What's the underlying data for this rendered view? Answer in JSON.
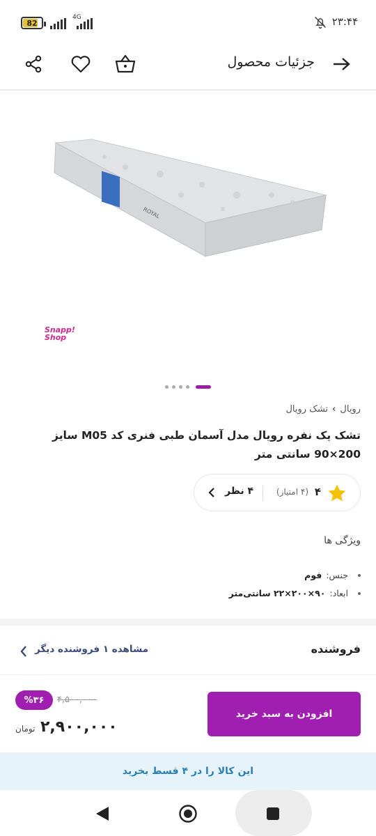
{
  "status_bar": {
    "time": "۲۳:۴۴",
    "battery": "82",
    "battery_level": 0.82,
    "network": "4G"
  },
  "app_bar": {
    "title": "جزئیات محصول",
    "icons": [
      "arrow-right-icon",
      "cart-icon",
      "heart-icon",
      "share-icon"
    ]
  },
  "product": {
    "brand_logo_line1": "Snapp!",
    "brand_logo_line2": "Shop",
    "breadcrumb": [
      "رویال",
      "تشک رویال"
    ],
    "title": "تشک یک نفره رویال مدل آسمان طبی فنری کد M05 سایز 200×90 سانتی متر",
    "images_count": 5,
    "active_image_index": 0,
    "rating": {
      "score": "۴",
      "count": "(۴ امتیاز)",
      "reviews": "۴ نظر"
    },
    "features_title": "ویژگی ها",
    "features": [
      {
        "label": "جنس:",
        "value": "فوم"
      },
      {
        "label": "ابعاد:",
        "value": "۹۰×۲۰۰×۲۲ سانتی‌متر"
      }
    ]
  },
  "seller": {
    "label": "فروشنده",
    "link": "مشاهده ۱ فروشنده دیگر"
  },
  "buy": {
    "button": "افزودن به سبد خرید",
    "discount": "%۳۶",
    "old_price": "۴,۵۰۰,۰۰۰",
    "price": "۲,۹۰۰,۰۰۰",
    "currency": "تومان",
    "accent_color": "#a01fb0"
  },
  "installment": "این کالا را در ۴ قسط بخرید",
  "nav": [
    "back-icon",
    "home-icon",
    "recents-icon"
  ]
}
